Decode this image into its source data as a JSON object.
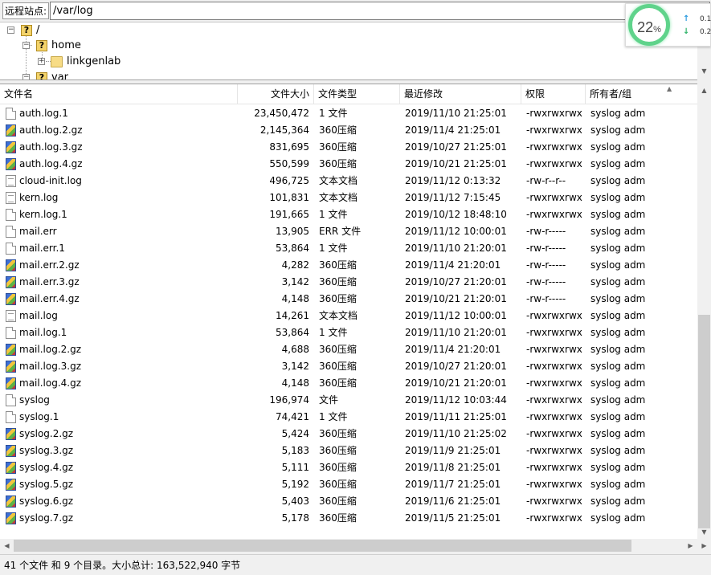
{
  "address_bar": {
    "label": "远程站点:",
    "path": "/var/log"
  },
  "tree": {
    "nodes": [
      {
        "label": "/",
        "expander": "−"
      },
      {
        "label": "home",
        "expander": "−"
      },
      {
        "label": "linkgenlab",
        "expander": "+"
      },
      {
        "label": "var",
        "expander": "−"
      }
    ]
  },
  "widget": {
    "percent": "22",
    "percent_unit": "%",
    "up_speed": "0.1",
    "down_speed": "0.2",
    "ring_color": "#5fd38b",
    "up_arrow": "↑",
    "down_arrow": "↓",
    "up_color": "#2b9be0",
    "down_color": "#2fb36a"
  },
  "columns": {
    "name": "文件名",
    "size": "文件大小",
    "type": "文件类型",
    "modified": "最近修改",
    "perms": "权限",
    "owner": "所有者/组"
  },
  "files": [
    {
      "name": "auth.log.1",
      "size": "23,450,472",
      "type": "1 文件",
      "modified": "2019/11/10 21:25:01",
      "perms": "-rwxrwxrwx",
      "owner": "syslog adm",
      "icon": "doc"
    },
    {
      "name": "auth.log.2.gz",
      "size": "2,145,364",
      "type": "360压缩",
      "modified": "2019/11/4 21:25:01",
      "perms": "-rwxrwxrwx",
      "owner": "syslog adm",
      "icon": "archive"
    },
    {
      "name": "auth.log.3.gz",
      "size": "831,695",
      "type": "360压缩",
      "modified": "2019/10/27 21:25:01",
      "perms": "-rwxrwxrwx",
      "owner": "syslog adm",
      "icon": "archive"
    },
    {
      "name": "auth.log.4.gz",
      "size": "550,599",
      "type": "360压缩",
      "modified": "2019/10/21 21:25:01",
      "perms": "-rwxrwxrwx",
      "owner": "syslog adm",
      "icon": "archive"
    },
    {
      "name": "cloud-init.log",
      "size": "496,725",
      "type": "文本文档",
      "modified": "2019/11/12 0:13:32",
      "perms": "-rw-r--r--",
      "owner": "syslog adm",
      "icon": "text"
    },
    {
      "name": "kern.log",
      "size": "101,831",
      "type": "文本文档",
      "modified": "2019/11/12 7:15:45",
      "perms": "-rwxrwxrwx",
      "owner": "syslog adm",
      "icon": "text"
    },
    {
      "name": "kern.log.1",
      "size": "191,665",
      "type": "1 文件",
      "modified": "2019/10/12 18:48:10",
      "perms": "-rwxrwxrwx",
      "owner": "syslog adm",
      "icon": "doc"
    },
    {
      "name": "mail.err",
      "size": "13,905",
      "type": "ERR 文件",
      "modified": "2019/11/12 10:00:01",
      "perms": "-rw-r-----",
      "owner": "syslog adm",
      "icon": "doc"
    },
    {
      "name": "mail.err.1",
      "size": "53,864",
      "type": "1 文件",
      "modified": "2019/11/10 21:20:01",
      "perms": "-rw-r-----",
      "owner": "syslog adm",
      "icon": "doc"
    },
    {
      "name": "mail.err.2.gz",
      "size": "4,282",
      "type": "360压缩",
      "modified": "2019/11/4 21:20:01",
      "perms": "-rw-r-----",
      "owner": "syslog adm",
      "icon": "archive"
    },
    {
      "name": "mail.err.3.gz",
      "size": "3,142",
      "type": "360压缩",
      "modified": "2019/10/27 21:20:01",
      "perms": "-rw-r-----",
      "owner": "syslog adm",
      "icon": "archive"
    },
    {
      "name": "mail.err.4.gz",
      "size": "4,148",
      "type": "360压缩",
      "modified": "2019/10/21 21:20:01",
      "perms": "-rw-r-----",
      "owner": "syslog adm",
      "icon": "archive"
    },
    {
      "name": "mail.log",
      "size": "14,261",
      "type": "文本文档",
      "modified": "2019/11/12 10:00:01",
      "perms": "-rwxrwxrwx",
      "owner": "syslog adm",
      "icon": "text"
    },
    {
      "name": "mail.log.1",
      "size": "53,864",
      "type": "1 文件",
      "modified": "2019/11/10 21:20:01",
      "perms": "-rwxrwxrwx",
      "owner": "syslog adm",
      "icon": "doc"
    },
    {
      "name": "mail.log.2.gz",
      "size": "4,688",
      "type": "360压缩",
      "modified": "2019/11/4 21:20:01",
      "perms": "-rwxrwxrwx",
      "owner": "syslog adm",
      "icon": "archive"
    },
    {
      "name": "mail.log.3.gz",
      "size": "3,142",
      "type": "360压缩",
      "modified": "2019/10/27 21:20:01",
      "perms": "-rwxrwxrwx",
      "owner": "syslog adm",
      "icon": "archive"
    },
    {
      "name": "mail.log.4.gz",
      "size": "4,148",
      "type": "360压缩",
      "modified": "2019/10/21 21:20:01",
      "perms": "-rwxrwxrwx",
      "owner": "syslog adm",
      "icon": "archive"
    },
    {
      "name": "syslog",
      "size": "196,974",
      "type": "文件",
      "modified": "2019/11/12 10:03:44",
      "perms": "-rwxrwxrwx",
      "owner": "syslog adm",
      "icon": "doc"
    },
    {
      "name": "syslog.1",
      "size": "74,421",
      "type": "1 文件",
      "modified": "2019/11/11 21:25:01",
      "perms": "-rwxrwxrwx",
      "owner": "syslog adm",
      "icon": "doc"
    },
    {
      "name": "syslog.2.gz",
      "size": "5,424",
      "type": "360压缩",
      "modified": "2019/11/10 21:25:02",
      "perms": "-rwxrwxrwx",
      "owner": "syslog adm",
      "icon": "archive"
    },
    {
      "name": "syslog.3.gz",
      "size": "5,183",
      "type": "360压缩",
      "modified": "2019/11/9 21:25:01",
      "perms": "-rwxrwxrwx",
      "owner": "syslog adm",
      "icon": "archive"
    },
    {
      "name": "syslog.4.gz",
      "size": "5,111",
      "type": "360压缩",
      "modified": "2019/11/8 21:25:01",
      "perms": "-rwxrwxrwx",
      "owner": "syslog adm",
      "icon": "archive"
    },
    {
      "name": "syslog.5.gz",
      "size": "5,192",
      "type": "360压缩",
      "modified": "2019/11/7 21:25:01",
      "perms": "-rwxrwxrwx",
      "owner": "syslog adm",
      "icon": "archive"
    },
    {
      "name": "syslog.6.gz",
      "size": "5,403",
      "type": "360压缩",
      "modified": "2019/11/6 21:25:01",
      "perms": "-rwxrwxrwx",
      "owner": "syslog adm",
      "icon": "archive"
    },
    {
      "name": "syslog.7.gz",
      "size": "5,178",
      "type": "360压缩",
      "modified": "2019/11/5 21:25:01",
      "perms": "-rwxrwxrwx",
      "owner": "syslog adm",
      "icon": "archive"
    }
  ],
  "status": {
    "text": "41 个文件 和 9 个目录。大小总计: 163,522,940 字节"
  }
}
